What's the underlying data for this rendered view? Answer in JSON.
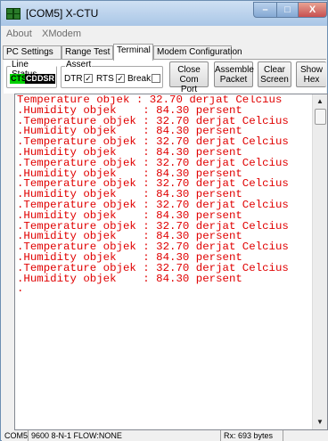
{
  "window": {
    "title": "[COM5] X-CTU",
    "icon": "xctu-app-icon"
  },
  "title_buttons": {
    "minimize_label": "–",
    "maximize_label": "□",
    "close_label": "X"
  },
  "menu": [
    "About",
    "XModem"
  ],
  "tabs": [
    "PC Settings",
    "Range Test",
    "Terminal",
    "Modem Configuration"
  ],
  "active_tab": "Terminal",
  "line_status": {
    "title": "Line Status",
    "leds": [
      "CTS",
      "CD",
      "DSR"
    ],
    "led_colors": {
      "CTS": "#00d000",
      "CD": "#000000",
      "DSR": "#000000"
    }
  },
  "assert": {
    "title": "Assert",
    "items": [
      {
        "label": "DTR",
        "checked": true
      },
      {
        "label": "RTS",
        "checked": true
      },
      {
        "label": "Break",
        "checked": false
      }
    ]
  },
  "buttons": {
    "close_port": [
      "Close",
      "Com Port"
    ],
    "assemble_packet": [
      "Assemble",
      "Packet"
    ],
    "clear_screen": [
      "Clear",
      "Screen"
    ],
    "show_hex": [
      "Show",
      "Hex"
    ]
  },
  "terminal": {
    "text_color": "#e00000",
    "lines": [
      "Temperature objek : 32.70 derjat Celcius",
      ".Humidity objek    : 84.30 persent",
      ".Temperature objek : 32.70 derjat Celcius",
      ".Humidity objek    : 84.30 persent",
      ".Temperature objek : 32.70 derjat Celcius",
      ".Humidity objek    : 84.30 persent",
      ".Temperature objek : 32.70 derjat Celcius",
      ".Humidity objek    : 84.30 persent",
      ".Temperature objek : 32.70 derjat Celcius",
      ".Humidity objek    : 84.30 persent",
      ".Temperature objek : 32.70 derjat Celcius",
      ".Humidity objek    : 84.30 persent",
      ".Temperature objek : 32.70 derjat Celcius",
      ".Humidity objek    : 84.30 persent",
      ".Temperature objek : 32.70 derjat Celcius",
      ".Humidity objek    : 84.30 persent",
      ".Temperature objek : 32.70 derjat Celcius",
      ".Humidity objek    : 84.30 persent",
      "."
    ]
  },
  "scrollbar": {
    "up_label": "▲",
    "down_label": "▼"
  },
  "status_bar": {
    "port": "COM5",
    "settings": "9600 8-N-1  FLOW:NONE",
    "rx": "Rx: 693 bytes"
  }
}
